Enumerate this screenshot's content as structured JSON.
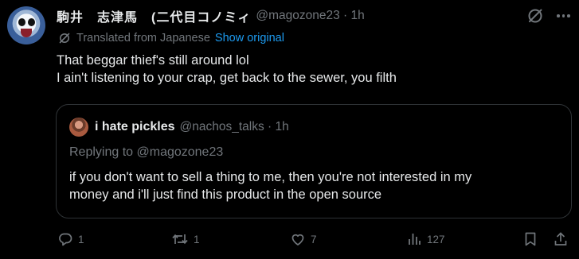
{
  "tweet": {
    "author_name": "駒井　志津馬　(二代目コノミィ",
    "author_handle": "@magozone23 · 1h",
    "translated_label": "Translated from Japanese",
    "show_original_label": "Show original",
    "text_lines": [
      "That beggar thief's still around lol",
      "I ain't listening to your crap, get back to the sewer, you filth"
    ]
  },
  "quote": {
    "author_name": "i hate pickles",
    "author_handle": "@nachos_talks · 1h",
    "replying_to": "Replying to @magozone23",
    "text_lines": [
      "if you don't want to sell a thing to me, then you're not interested in my",
      "money and i'll just find this product in the open source"
    ]
  },
  "actions": {
    "reply_count": "1",
    "repost_count": "1",
    "like_count": "7",
    "view_count": "127"
  },
  "colors": {
    "background": "#000000",
    "text": "#e7e9ea",
    "secondary": "#71767b",
    "link": "#1d9bf0",
    "border": "#2f3336"
  },
  "icons": [
    "grok-icon",
    "more-icon",
    "translate-icon",
    "reply-icon",
    "repost-icon",
    "like-icon",
    "views-icon",
    "bookmark-icon",
    "share-icon"
  ]
}
